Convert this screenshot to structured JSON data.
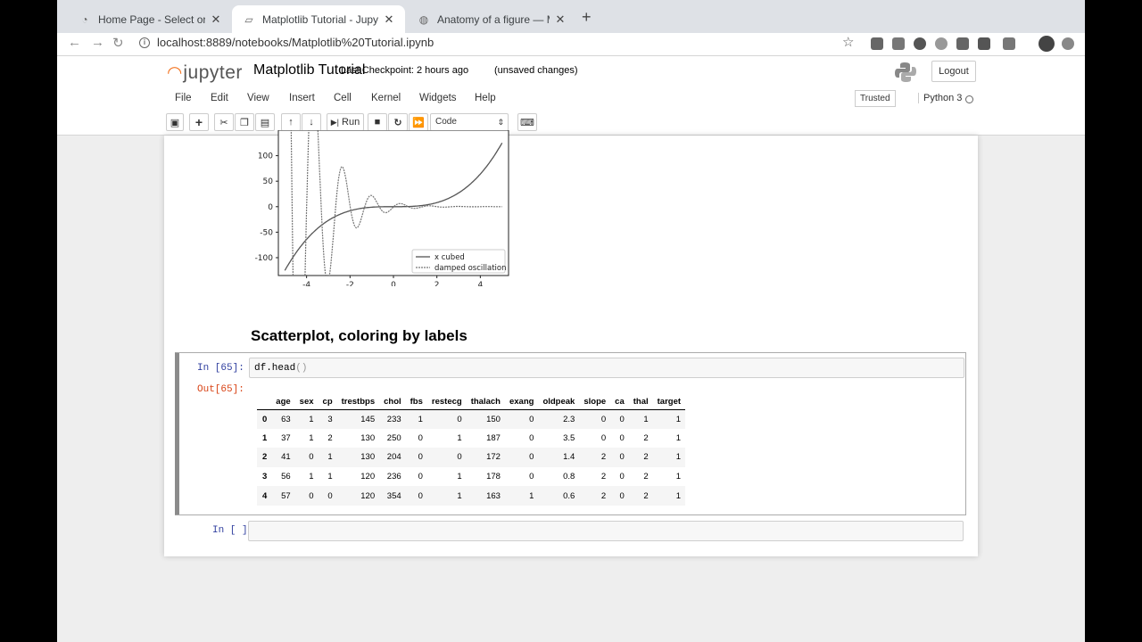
{
  "browser": {
    "tabs": [
      {
        "title": "Home Page - Select or create a notebook",
        "active": false
      },
      {
        "title": "Matplotlib Tutorial - Jupyter Notebook",
        "active": true
      },
      {
        "title": "Anatomy of a figure — Matplotlib",
        "active": false
      }
    ],
    "url": "localhost:8889/notebooks/Matplotlib%20Tutorial.ipynb"
  },
  "jupyter": {
    "logo_text": "jupyter",
    "notebook_name": "Matplotlib Tutorial",
    "checkpoint": "Last Checkpoint: 2 hours ago",
    "unsaved": "(unsaved changes)",
    "logout_label": "Logout",
    "menu": [
      "File",
      "Edit",
      "View",
      "Insert",
      "Cell",
      "Kernel",
      "Widgets",
      "Help"
    ],
    "trusted_label": "Trusted",
    "kernel_name": "Python 3",
    "run_label": "Run",
    "cell_type": "Code"
  },
  "chart_data": {
    "type": "line",
    "x_ticks": [
      -4,
      -2,
      0,
      2,
      4
    ],
    "y_ticks": [
      -100,
      -50,
      0,
      50,
      100
    ],
    "xlim": [
      -5.3,
      5.3
    ],
    "ylim": [
      -135,
      150
    ],
    "series": [
      {
        "name": "x cubed",
        "formula": "x^3",
        "x_range": [
          -5,
          5
        ]
      },
      {
        "name": "damped oscillation",
        "x_range": [
          -5,
          5
        ]
      }
    ],
    "legend": "lower-right"
  },
  "notebook": {
    "heading": "Scatterplot, coloring by labels",
    "in_prompt": "In [65]:",
    "out_prompt": "Out[65]:",
    "code_main": "df.head",
    "code_parens": "()",
    "empty_prompt": "In [ ]:",
    "table": {
      "columns": [
        "age",
        "sex",
        "cp",
        "trestbps",
        "chol",
        "fbs",
        "restecg",
        "thalach",
        "exang",
        "oldpeak",
        "slope",
        "ca",
        "thal",
        "target"
      ],
      "rows": [
        {
          "index": "0",
          "values": [
            "63",
            "1",
            "3",
            "145",
            "233",
            "1",
            "0",
            "150",
            "0",
            "2.3",
            "0",
            "0",
            "1",
            "1"
          ]
        },
        {
          "index": "1",
          "values": [
            "37",
            "1",
            "2",
            "130",
            "250",
            "0",
            "1",
            "187",
            "0",
            "3.5",
            "0",
            "0",
            "2",
            "1"
          ]
        },
        {
          "index": "2",
          "values": [
            "41",
            "0",
            "1",
            "130",
            "204",
            "0",
            "0",
            "172",
            "0",
            "1.4",
            "2",
            "0",
            "2",
            "1"
          ]
        },
        {
          "index": "3",
          "values": [
            "56",
            "1",
            "1",
            "120",
            "236",
            "0",
            "1",
            "178",
            "0",
            "0.8",
            "2",
            "0",
            "2",
            "1"
          ]
        },
        {
          "index": "4",
          "values": [
            "57",
            "0",
            "0",
            "120",
            "354",
            "0",
            "1",
            "163",
            "1",
            "0.6",
            "2",
            "0",
            "2",
            "1"
          ]
        }
      ]
    }
  }
}
